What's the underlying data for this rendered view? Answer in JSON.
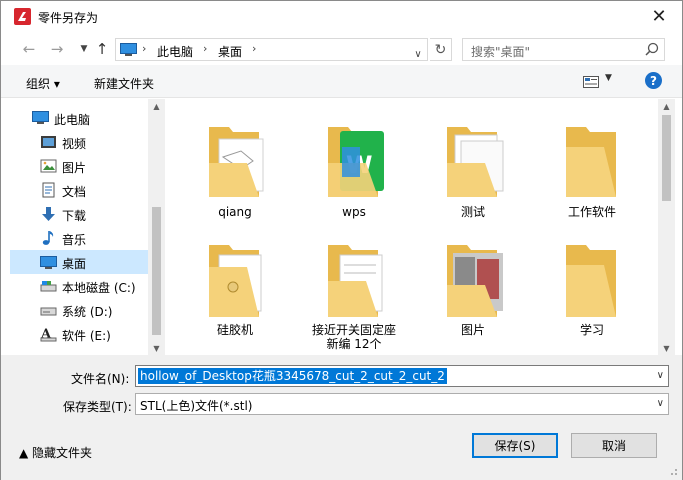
{
  "window": {
    "title": "零件另存为",
    "close_label": "✕"
  },
  "nav": {
    "back": "←",
    "forward": "→",
    "up": "↑",
    "breadcrumb": [
      "此电脑",
      "桌面"
    ],
    "refresh": "↻",
    "search_placeholder": "搜索\"桌面\""
  },
  "toolbar": {
    "organize_label": "组织 ▾",
    "new_folder_label": "新建文件夹",
    "help_label": "?"
  },
  "sidebar": {
    "items": [
      {
        "label": "此电脑",
        "icon": "computer-icon"
      },
      {
        "label": "视频",
        "icon": "video-icon"
      },
      {
        "label": "图片",
        "icon": "pictures-icon"
      },
      {
        "label": "文档",
        "icon": "documents-icon"
      },
      {
        "label": "下载",
        "icon": "download-icon"
      },
      {
        "label": "音乐",
        "icon": "music-icon"
      },
      {
        "label": "桌面",
        "icon": "desktop-icon",
        "selected": true
      },
      {
        "label": "本地磁盘 (C:)",
        "icon": "drive-icon"
      },
      {
        "label": "系统 (D:)",
        "icon": "drive-icon"
      },
      {
        "label": "软件 (E:)",
        "icon": "drive-icon"
      }
    ]
  },
  "files": [
    {
      "label": "qiang",
      "preview": "document"
    },
    {
      "label": "wps",
      "preview": "wps"
    },
    {
      "label": "测试",
      "preview": "document"
    },
    {
      "label": "工作软件",
      "preview": "empty"
    },
    {
      "label": "硅胶机",
      "preview": "image"
    },
    {
      "label": "接近开关固定座\n新编  12个",
      "preview": "document"
    },
    {
      "label": "图片",
      "preview": "photo"
    },
    {
      "label": "学习",
      "preview": "empty"
    }
  ],
  "form": {
    "filename_label": "文件名(N):",
    "filename_value": "hollow_of_Desktop花瓶3345678_cut_2_cut_2_cut_2",
    "filetype_label": "保存类型(T):",
    "filetype_value": "STL(上色)文件(*.stl)",
    "hide_folders_label": "▲  隐藏文件夹",
    "save_label": "保存(S)",
    "cancel_label": "取消"
  },
  "colors": {
    "accent": "#0078d7",
    "folder": "#f5d27a",
    "selected_bg": "#cce8ff"
  }
}
